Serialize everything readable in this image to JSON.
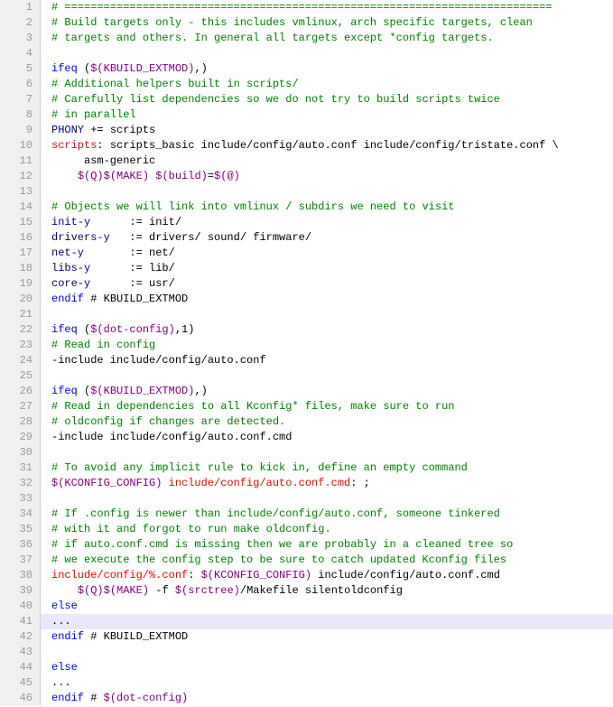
{
  "lines": [
    {
      "n": 1,
      "hl": false,
      "seg": [
        {
          "cls": "c-comment",
          "t": "# ==========================================================================="
        }
      ]
    },
    {
      "n": 2,
      "hl": false,
      "seg": [
        {
          "cls": "c-comment",
          "t": "# Build targets only - this includes vmlinux, arch specific targets, clean"
        }
      ]
    },
    {
      "n": 3,
      "hl": false,
      "seg": [
        {
          "cls": "c-comment",
          "t": "# targets and others. In general all targets except *config targets."
        }
      ]
    },
    {
      "n": 4,
      "hl": false,
      "seg": []
    },
    {
      "n": 5,
      "hl": false,
      "seg": [
        {
          "cls": "c-keyword",
          "t": "ifeq"
        },
        {
          "cls": "c-plain",
          "t": " ("
        },
        {
          "cls": "c-var",
          "t": "$(KBUILD_EXTMOD)"
        },
        {
          "cls": "c-plain",
          "t": ",)"
        }
      ]
    },
    {
      "n": 6,
      "hl": false,
      "seg": [
        {
          "cls": "c-comment",
          "t": "# Additional helpers built in scripts/"
        }
      ]
    },
    {
      "n": 7,
      "hl": false,
      "seg": [
        {
          "cls": "c-comment",
          "t": "# Carefully list dependencies so we do not try to build scripts twice"
        }
      ]
    },
    {
      "n": 8,
      "hl": false,
      "seg": [
        {
          "cls": "c-comment",
          "t": "# in parallel"
        }
      ]
    },
    {
      "n": 9,
      "hl": false,
      "seg": [
        {
          "cls": "c-func",
          "t": "PHONY"
        },
        {
          "cls": "c-plain",
          "t": " += scripts"
        }
      ]
    },
    {
      "n": 10,
      "hl": false,
      "seg": [
        {
          "cls": "c-target",
          "t": "scripts"
        },
        {
          "cls": "c-plain",
          "t": ": scripts_basic include/config/auto.conf include/config/tristate.conf \\"
        }
      ]
    },
    {
      "n": 11,
      "hl": false,
      "seg": [
        {
          "cls": "c-plain",
          "t": "     asm-generic"
        }
      ]
    },
    {
      "n": 12,
      "hl": false,
      "seg": [
        {
          "cls": "c-plain",
          "t": "    "
        },
        {
          "cls": "c-var",
          "t": "$(Q)"
        },
        {
          "cls": "c-var",
          "t": "$(MAKE)"
        },
        {
          "cls": "c-plain",
          "t": " "
        },
        {
          "cls": "c-var",
          "t": "$(build)"
        },
        {
          "cls": "c-plain",
          "t": "="
        },
        {
          "cls": "c-var",
          "t": "$(@)"
        }
      ]
    },
    {
      "n": 13,
      "hl": false,
      "seg": []
    },
    {
      "n": 14,
      "hl": false,
      "seg": [
        {
          "cls": "c-comment",
          "t": "# Objects we will link into vmlinux / subdirs we need to visit"
        }
      ]
    },
    {
      "n": 15,
      "hl": false,
      "seg": [
        {
          "cls": "c-func",
          "t": "init-y"
        },
        {
          "cls": "c-plain",
          "t": "      := init/"
        }
      ]
    },
    {
      "n": 16,
      "hl": false,
      "seg": [
        {
          "cls": "c-func",
          "t": "drivers-y"
        },
        {
          "cls": "c-plain",
          "t": "   := drivers/ sound/ firmware/"
        }
      ]
    },
    {
      "n": 17,
      "hl": false,
      "seg": [
        {
          "cls": "c-func",
          "t": "net-y"
        },
        {
          "cls": "c-plain",
          "t": "       := net/"
        }
      ]
    },
    {
      "n": 18,
      "hl": false,
      "seg": [
        {
          "cls": "c-func",
          "t": "libs-y"
        },
        {
          "cls": "c-plain",
          "t": "      := lib/"
        }
      ]
    },
    {
      "n": 19,
      "hl": false,
      "seg": [
        {
          "cls": "c-func",
          "t": "core-y"
        },
        {
          "cls": "c-plain",
          "t": "      := usr/"
        }
      ]
    },
    {
      "n": 20,
      "hl": false,
      "seg": [
        {
          "cls": "c-keyword",
          "t": "endif"
        },
        {
          "cls": "c-plain",
          "t": " # KBUILD_EXTMOD"
        }
      ]
    },
    {
      "n": 21,
      "hl": false,
      "seg": []
    },
    {
      "n": 22,
      "hl": false,
      "seg": [
        {
          "cls": "c-keyword",
          "t": "ifeq"
        },
        {
          "cls": "c-plain",
          "t": " ("
        },
        {
          "cls": "c-var",
          "t": "$(dot-config)"
        },
        {
          "cls": "c-plain",
          "t": ",1)"
        }
      ]
    },
    {
      "n": 23,
      "hl": false,
      "seg": [
        {
          "cls": "c-comment",
          "t": "# Read in config"
        }
      ]
    },
    {
      "n": 24,
      "hl": false,
      "seg": [
        {
          "cls": "c-plain",
          "t": "-include include/config/auto.conf"
        }
      ]
    },
    {
      "n": 25,
      "hl": false,
      "seg": []
    },
    {
      "n": 26,
      "hl": false,
      "seg": [
        {
          "cls": "c-keyword",
          "t": "ifeq"
        },
        {
          "cls": "c-plain",
          "t": " ("
        },
        {
          "cls": "c-var",
          "t": "$(KBUILD_EXTMOD)"
        },
        {
          "cls": "c-plain",
          "t": ",)"
        }
      ]
    },
    {
      "n": 27,
      "hl": false,
      "seg": [
        {
          "cls": "c-comment",
          "t": "# Read in dependencies to all Kconfig* files, make sure to run"
        }
      ]
    },
    {
      "n": 28,
      "hl": false,
      "seg": [
        {
          "cls": "c-comment",
          "t": "# oldconfig if changes are detected."
        }
      ]
    },
    {
      "n": 29,
      "hl": false,
      "seg": [
        {
          "cls": "c-plain",
          "t": "-include include/config/auto.conf.cmd"
        }
      ]
    },
    {
      "n": 30,
      "hl": false,
      "seg": []
    },
    {
      "n": 31,
      "hl": false,
      "seg": [
        {
          "cls": "c-comment",
          "t": "# To avoid any implicit rule to kick in, define an empty command"
        }
      ]
    },
    {
      "n": 32,
      "hl": false,
      "seg": [
        {
          "cls": "c-var",
          "t": "$(KCONFIG_CONFIG)"
        },
        {
          "cls": "c-plain",
          "t": " "
        },
        {
          "cls": "c-target",
          "t": "include/config/auto.conf.cmd"
        },
        {
          "cls": "c-plain",
          "t": ": ;"
        }
      ]
    },
    {
      "n": 33,
      "hl": false,
      "seg": []
    },
    {
      "n": 34,
      "hl": false,
      "seg": [
        {
          "cls": "c-comment",
          "t": "# If .config is newer than include/config/auto.conf, someone tinkered"
        }
      ]
    },
    {
      "n": 35,
      "hl": false,
      "seg": [
        {
          "cls": "c-comment",
          "t": "# with it and forgot to run make oldconfig."
        }
      ]
    },
    {
      "n": 36,
      "hl": false,
      "seg": [
        {
          "cls": "c-comment",
          "t": "# if auto.conf.cmd is missing then we are probably in a cleaned tree so"
        }
      ]
    },
    {
      "n": 37,
      "hl": false,
      "seg": [
        {
          "cls": "c-comment",
          "t": "# we execute the config step to be sure to catch updated Kconfig files"
        }
      ]
    },
    {
      "n": 38,
      "hl": false,
      "seg": [
        {
          "cls": "c-target",
          "t": "include/config/%.conf"
        },
        {
          "cls": "c-plain",
          "t": ": "
        },
        {
          "cls": "c-var",
          "t": "$(KCONFIG_CONFIG)"
        },
        {
          "cls": "c-plain",
          "t": " include/config/auto.conf.cmd"
        }
      ]
    },
    {
      "n": 39,
      "hl": false,
      "seg": [
        {
          "cls": "c-plain",
          "t": "    "
        },
        {
          "cls": "c-var",
          "t": "$(Q)"
        },
        {
          "cls": "c-var",
          "t": "$(MAKE)"
        },
        {
          "cls": "c-plain",
          "t": " -f "
        },
        {
          "cls": "c-var",
          "t": "$(srctree)"
        },
        {
          "cls": "c-plain",
          "t": "/Makefile silentoldconfig"
        }
      ]
    },
    {
      "n": 40,
      "hl": false,
      "seg": [
        {
          "cls": "c-keyword",
          "t": "else"
        }
      ]
    },
    {
      "n": 41,
      "hl": true,
      "seg": [
        {
          "cls": "c-plain",
          "t": "..."
        }
      ]
    },
    {
      "n": 42,
      "hl": false,
      "seg": [
        {
          "cls": "c-keyword",
          "t": "endif"
        },
        {
          "cls": "c-plain",
          "t": " # KBUILD_EXTMOD"
        }
      ]
    },
    {
      "n": 43,
      "hl": false,
      "seg": []
    },
    {
      "n": 44,
      "hl": false,
      "seg": [
        {
          "cls": "c-keyword",
          "t": "else"
        }
      ]
    },
    {
      "n": 45,
      "hl": false,
      "seg": [
        {
          "cls": "c-plain",
          "t": "..."
        }
      ]
    },
    {
      "n": 46,
      "hl": false,
      "seg": [
        {
          "cls": "c-keyword",
          "t": "endif"
        },
        {
          "cls": "c-plain",
          "t": " # "
        },
        {
          "cls": "c-var",
          "t": "$(dot-config)"
        }
      ]
    }
  ]
}
